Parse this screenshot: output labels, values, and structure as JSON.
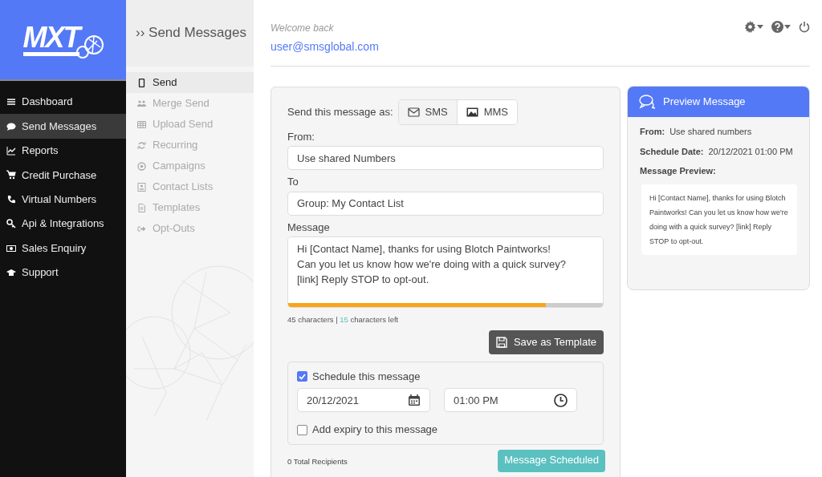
{
  "logo": {
    "text": "MXT"
  },
  "sidebar": {
    "items": [
      {
        "label": "Dashboard",
        "selected": false
      },
      {
        "label": "Send Messages",
        "selected": true
      },
      {
        "label": "Reports",
        "selected": false
      },
      {
        "label": "Credit Purchase",
        "selected": false
      },
      {
        "label": "Virtual Numbers",
        "selected": false
      },
      {
        "label": "Api & Integrations",
        "selected": false
      },
      {
        "label": "Sales Enquiry",
        "selected": false
      },
      {
        "label": "Support",
        "selected": false
      }
    ]
  },
  "subnav": {
    "title": "›› Send Messages",
    "items": [
      {
        "label": "Send",
        "selected": true
      },
      {
        "label": "Merge Send",
        "selected": false
      },
      {
        "label": "Upload Send",
        "selected": false
      },
      {
        "label": "Recurring",
        "selected": false
      },
      {
        "label": "Campaigns",
        "selected": false
      },
      {
        "label": "Contact Lists",
        "selected": false
      },
      {
        "label": "Templates",
        "selected": false
      },
      {
        "label": "Opt-Outs",
        "selected": false
      }
    ]
  },
  "header": {
    "welcome": "Welcome back",
    "email": "user@smsglobal.com"
  },
  "compose": {
    "send_as_label": "Send this message as:",
    "send_as": [
      {
        "label": "SMS",
        "selected": true
      },
      {
        "label": "MMS",
        "selected": false
      }
    ],
    "from_label": "From:",
    "from_value": "Use shared Numbers",
    "to_label": "To",
    "to_value": "Group: My Contact List",
    "message_label": "Message",
    "message": "Hi [Contact Name], thanks for using Blotch Paintworks!\nCan you let us know how we're doing with a quick survey?\n[link] Reply STOP to opt-out.",
    "message_fill": {
      "level": 0.82
    },
    "char_count": "45 characters",
    "separator": "|",
    "chars_left_count": "15",
    "chars_left_label": "characters left",
    "save_template": "Save as Template",
    "schedule": {
      "label": "Schedule this message",
      "checked": true,
      "date": "20/12/2021",
      "time": "01:00 PM"
    },
    "expiry": {
      "label": "Add expiry to this message",
      "checked": false
    },
    "recipients": "0 Total Recipients",
    "submit": "Message Scheduled"
  },
  "preview": {
    "title": "Preview Message",
    "from_label": "From:",
    "from_value": "Use shared numbers",
    "date_label": "Schedule Date:",
    "date_value": "20/12/2021 01:00 PM",
    "message_label": "Message Preview:",
    "message": "Hi [Contact Name], thanks for using Blotch Paintworks! Can you let us know how we're doing with a quick survey? [link] Reply STOP to opt-out."
  }
}
